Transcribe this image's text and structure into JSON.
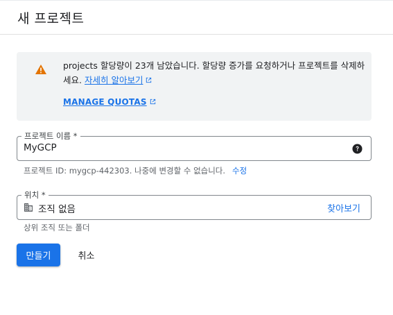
{
  "header": {
    "title": "새 프로젝트"
  },
  "quota_banner": {
    "message": "projects 할당량이 23개 남았습니다. 할당량 증가를 요청하거나 프로젝트를 삭제하세요.",
    "learn_more_link": "자세히 알아보기",
    "manage_quotas_link": "MANAGE QUOTAS",
    "warning_color": "#e37400"
  },
  "project_name": {
    "label": "프로젝트 이름 *",
    "value": "MyGCP",
    "hint": "프로젝트 ID: mygcp-442303. 나중에 변경할 수 없습니다.",
    "edit_link": "수정"
  },
  "location": {
    "label": "위치 *",
    "value": "조직 없음",
    "browse_link": "찾아보기",
    "hint": "상위 조직 또는 폴더"
  },
  "actions": {
    "create": "만들기",
    "cancel": "취소"
  },
  "colors": {
    "accent": "#1a73e8",
    "banner_bg": "#f1f3f4"
  }
}
